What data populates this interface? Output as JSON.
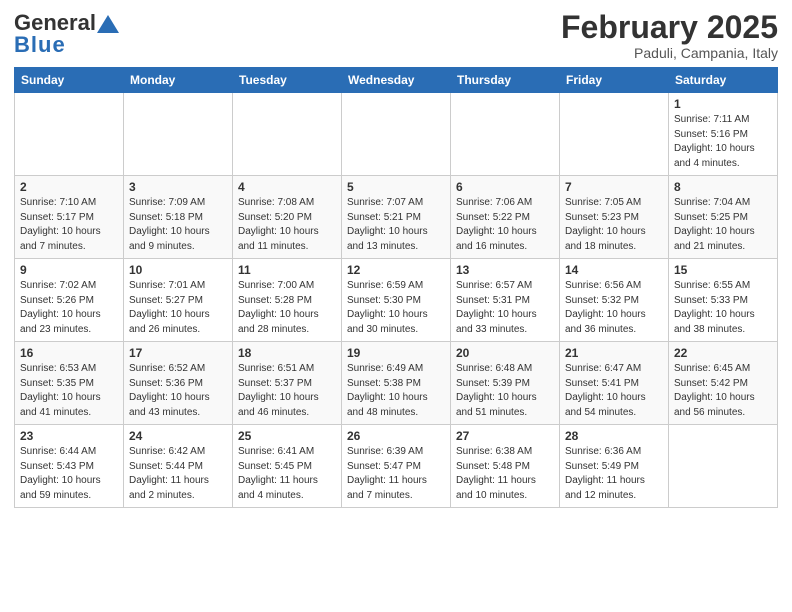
{
  "header": {
    "logo_general": "General",
    "logo_blue": "Blue",
    "month_title": "February 2025",
    "location": "Paduli, Campania, Italy"
  },
  "weekdays": [
    "Sunday",
    "Monday",
    "Tuesday",
    "Wednesday",
    "Thursday",
    "Friday",
    "Saturday"
  ],
  "weeks": [
    [
      {
        "day": "",
        "info": ""
      },
      {
        "day": "",
        "info": ""
      },
      {
        "day": "",
        "info": ""
      },
      {
        "day": "",
        "info": ""
      },
      {
        "day": "",
        "info": ""
      },
      {
        "day": "",
        "info": ""
      },
      {
        "day": "1",
        "info": "Sunrise: 7:11 AM\nSunset: 5:16 PM\nDaylight: 10 hours\nand 4 minutes."
      }
    ],
    [
      {
        "day": "2",
        "info": "Sunrise: 7:10 AM\nSunset: 5:17 PM\nDaylight: 10 hours\nand 7 minutes."
      },
      {
        "day": "3",
        "info": "Sunrise: 7:09 AM\nSunset: 5:18 PM\nDaylight: 10 hours\nand 9 minutes."
      },
      {
        "day": "4",
        "info": "Sunrise: 7:08 AM\nSunset: 5:20 PM\nDaylight: 10 hours\nand 11 minutes."
      },
      {
        "day": "5",
        "info": "Sunrise: 7:07 AM\nSunset: 5:21 PM\nDaylight: 10 hours\nand 13 minutes."
      },
      {
        "day": "6",
        "info": "Sunrise: 7:06 AM\nSunset: 5:22 PM\nDaylight: 10 hours\nand 16 minutes."
      },
      {
        "day": "7",
        "info": "Sunrise: 7:05 AM\nSunset: 5:23 PM\nDaylight: 10 hours\nand 18 minutes."
      },
      {
        "day": "8",
        "info": "Sunrise: 7:04 AM\nSunset: 5:25 PM\nDaylight: 10 hours\nand 21 minutes."
      }
    ],
    [
      {
        "day": "9",
        "info": "Sunrise: 7:02 AM\nSunset: 5:26 PM\nDaylight: 10 hours\nand 23 minutes."
      },
      {
        "day": "10",
        "info": "Sunrise: 7:01 AM\nSunset: 5:27 PM\nDaylight: 10 hours\nand 26 minutes."
      },
      {
        "day": "11",
        "info": "Sunrise: 7:00 AM\nSunset: 5:28 PM\nDaylight: 10 hours\nand 28 minutes."
      },
      {
        "day": "12",
        "info": "Sunrise: 6:59 AM\nSunset: 5:30 PM\nDaylight: 10 hours\nand 30 minutes."
      },
      {
        "day": "13",
        "info": "Sunrise: 6:57 AM\nSunset: 5:31 PM\nDaylight: 10 hours\nand 33 minutes."
      },
      {
        "day": "14",
        "info": "Sunrise: 6:56 AM\nSunset: 5:32 PM\nDaylight: 10 hours\nand 36 minutes."
      },
      {
        "day": "15",
        "info": "Sunrise: 6:55 AM\nSunset: 5:33 PM\nDaylight: 10 hours\nand 38 minutes."
      }
    ],
    [
      {
        "day": "16",
        "info": "Sunrise: 6:53 AM\nSunset: 5:35 PM\nDaylight: 10 hours\nand 41 minutes."
      },
      {
        "day": "17",
        "info": "Sunrise: 6:52 AM\nSunset: 5:36 PM\nDaylight: 10 hours\nand 43 minutes."
      },
      {
        "day": "18",
        "info": "Sunrise: 6:51 AM\nSunset: 5:37 PM\nDaylight: 10 hours\nand 46 minutes."
      },
      {
        "day": "19",
        "info": "Sunrise: 6:49 AM\nSunset: 5:38 PM\nDaylight: 10 hours\nand 48 minutes."
      },
      {
        "day": "20",
        "info": "Sunrise: 6:48 AM\nSunset: 5:39 PM\nDaylight: 10 hours\nand 51 minutes."
      },
      {
        "day": "21",
        "info": "Sunrise: 6:47 AM\nSunset: 5:41 PM\nDaylight: 10 hours\nand 54 minutes."
      },
      {
        "day": "22",
        "info": "Sunrise: 6:45 AM\nSunset: 5:42 PM\nDaylight: 10 hours\nand 56 minutes."
      }
    ],
    [
      {
        "day": "23",
        "info": "Sunrise: 6:44 AM\nSunset: 5:43 PM\nDaylight: 10 hours\nand 59 minutes."
      },
      {
        "day": "24",
        "info": "Sunrise: 6:42 AM\nSunset: 5:44 PM\nDaylight: 11 hours\nand 2 minutes."
      },
      {
        "day": "25",
        "info": "Sunrise: 6:41 AM\nSunset: 5:45 PM\nDaylight: 11 hours\nand 4 minutes."
      },
      {
        "day": "26",
        "info": "Sunrise: 6:39 AM\nSunset: 5:47 PM\nDaylight: 11 hours\nand 7 minutes."
      },
      {
        "day": "27",
        "info": "Sunrise: 6:38 AM\nSunset: 5:48 PM\nDaylight: 11 hours\nand 10 minutes."
      },
      {
        "day": "28",
        "info": "Sunrise: 6:36 AM\nSunset: 5:49 PM\nDaylight: 11 hours\nand 12 minutes."
      },
      {
        "day": "",
        "info": ""
      }
    ]
  ]
}
